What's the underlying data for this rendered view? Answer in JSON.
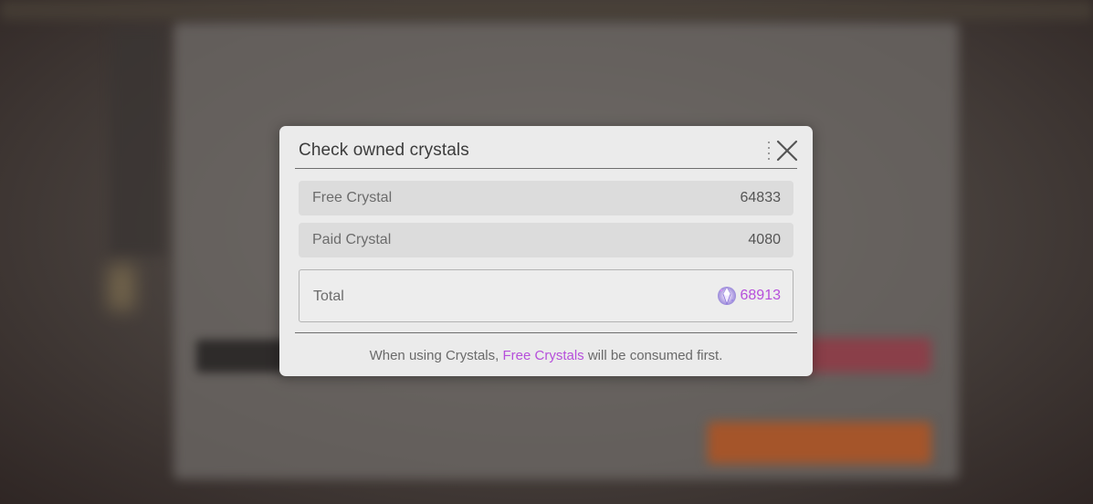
{
  "dialog": {
    "title": "Check owned crystals",
    "close_icon": "close-icon"
  },
  "rows": [
    {
      "label": "Free Crystal",
      "value": "64833"
    },
    {
      "label": "Paid Crystal",
      "value": "4080"
    }
  ],
  "total": {
    "label": "Total",
    "icon": "crystal-icon",
    "value": "68913"
  },
  "note": {
    "prefix": "When using Crystals, ",
    "highlight": "Free Crystals",
    "suffix": " will be consumed first."
  },
  "colors": {
    "accent": "#b64fdb",
    "dialog_bg": "#ebebeb",
    "row_bg": "#dcdcdc"
  }
}
